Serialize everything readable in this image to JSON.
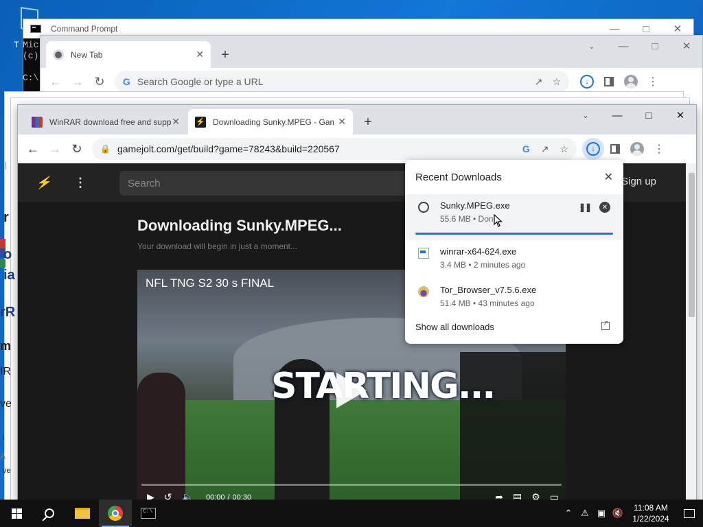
{
  "cmd": {
    "title": "Command Prompt",
    "lines": [
      "Mic",
      "(c)",
      "C:\\"
    ],
    "frag_t": "T"
  },
  "chrome_back": {
    "tab_label": "New Tab",
    "omnibox_placeholder": "Search Google or type a URL"
  },
  "chrome_front": {
    "tabs": [
      {
        "label": "WinRAR download free and supp"
      },
      {
        "label": "Downloading Sunky.MPEG - Gam"
      }
    ],
    "url": "gamejolt.com/get/build?game=78243&build=220567"
  },
  "gamejolt": {
    "search_placeholder": "Search",
    "signup": "Sign up",
    "title": "Downloading Sunky.MPEG...",
    "subtitle": "Your download will begin in just a moment...",
    "video": {
      "title": "NFL TNG S2 30 s FINAL",
      "caption": "STARTING...",
      "time_current": "00:00",
      "time_total": "00:30",
      "progress": 0
    }
  },
  "downloads": {
    "title": "Recent Downloads",
    "items": [
      {
        "name": "Sunky.MPEG.exe",
        "meta": "55.6 MB • Done",
        "state": "active",
        "progress": 1.0,
        "icon": "circle-icon"
      },
      {
        "name": "winrar-x64-624.exe",
        "meta": "3.4 MB • 2 minutes ago",
        "icon": "exe-icon"
      },
      {
        "name": "Tor_Browser_v7.5.6.exe",
        "meta": "51.4 MB • 43 minutes ago",
        "icon": "onion-icon"
      }
    ],
    "show_all": "Show all downloads"
  },
  "left_fragments": [
    "Th",
    "o",
    "ia",
    "r",
    "rR",
    "m",
    "IR",
    "ve",
    "i",
    "A",
    "ve",
    "A"
  ],
  "taskbar": {
    "time": "11:08 AM",
    "date": "1/22/2024"
  },
  "colors": {
    "accent": "#1a73e8",
    "gamejolt_bg": "#191919",
    "taskbar": "#101010"
  }
}
